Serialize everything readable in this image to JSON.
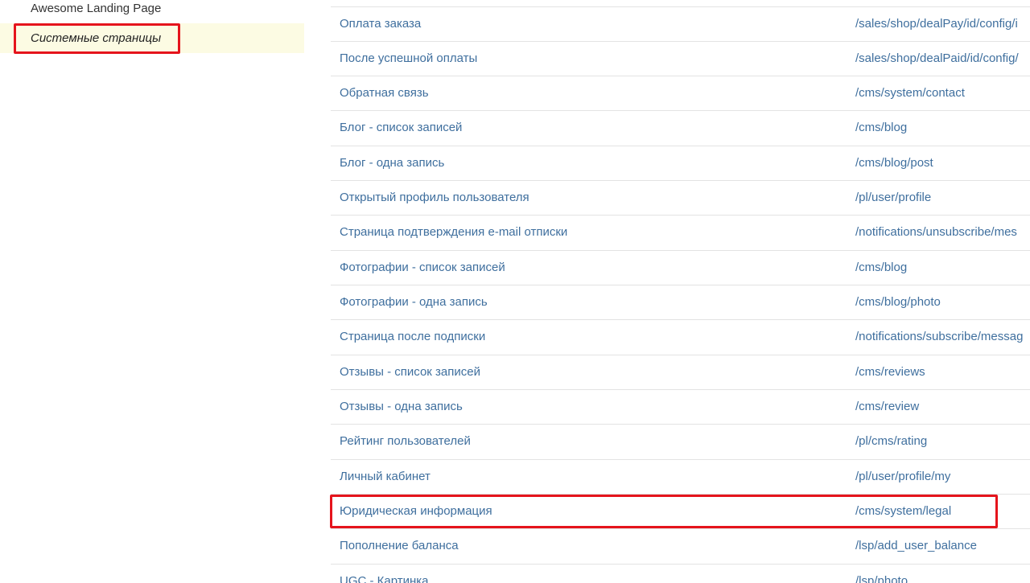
{
  "sidebar": {
    "items": [
      {
        "label": "Awesome Landing Page"
      },
      {
        "label": "Системные страницы"
      }
    ]
  },
  "table": {
    "rows": [
      {
        "name": "Оплата заказа",
        "url": "/sales/shop/dealPay/id/config/i"
      },
      {
        "name": "После успешной оплаты",
        "url": "/sales/shop/dealPaid/id/config/"
      },
      {
        "name": "Обратная связь",
        "url": "/cms/system/contact"
      },
      {
        "name": "Блог - список записей",
        "url": "/cms/blog"
      },
      {
        "name": "Блог - одна запись",
        "url": "/cms/blog/post"
      },
      {
        "name": "Открытый профиль пользователя",
        "url": "/pl/user/profile"
      },
      {
        "name": "Страница подтверждения e-mail отписки",
        "url": "/notifications/unsubscribe/mes"
      },
      {
        "name": "Фотографии - список записей",
        "url": "/cms/blog"
      },
      {
        "name": "Фотографии - одна запись",
        "url": "/cms/blog/photo"
      },
      {
        "name": "Страница после подписки",
        "url": "/notifications/subscribe/messag"
      },
      {
        "name": "Отзывы - список записей",
        "url": "/cms/reviews"
      },
      {
        "name": "Отзывы - одна запись",
        "url": "/cms/review"
      },
      {
        "name": "Рейтинг пользователей",
        "url": "/pl/cms/rating"
      },
      {
        "name": "Личный кабинет",
        "url": "/pl/user/profile/my"
      },
      {
        "name": "Юридическая информация",
        "url": "/cms/system/legal"
      },
      {
        "name": "Пополнение баланса",
        "url": "/lsp/add_user_balance"
      },
      {
        "name": "UGC - Картинка",
        "url": "/lsp/photo"
      }
    ]
  },
  "colors": {
    "link": "#3f6f9e",
    "highlight_border": "#e5141c",
    "active_background": "#fcfbe3",
    "row_divider": "#e3e3e3"
  }
}
